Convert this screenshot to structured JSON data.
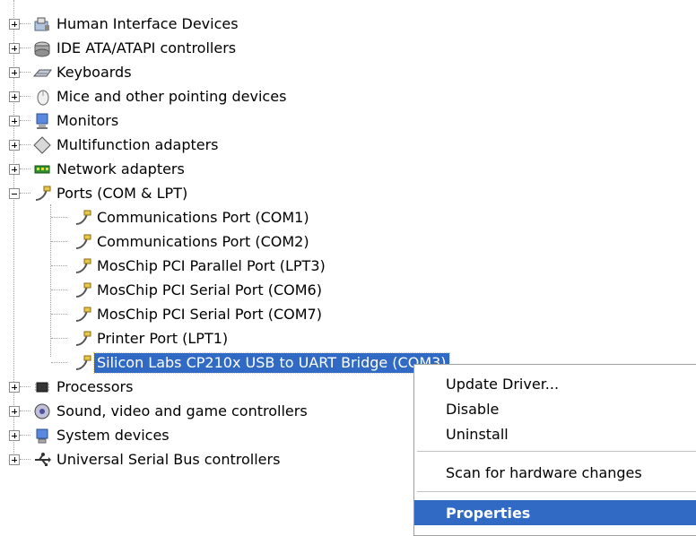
{
  "tree": {
    "categories": [
      {
        "label": "Human Interface Devices",
        "icon": "hid-icon"
      },
      {
        "label": "IDE ATA/ATAPI controllers",
        "icon": "ide-controller-icon"
      },
      {
        "label": "Keyboards",
        "icon": "keyboard-icon"
      },
      {
        "label": "Mice and other pointing devices",
        "icon": "mouse-icon"
      },
      {
        "label": "Monitors",
        "icon": "monitor-icon"
      },
      {
        "label": "Multifunction adapters",
        "icon": "multifunction-icon"
      },
      {
        "label": "Network adapters",
        "icon": "network-adapter-icon"
      },
      {
        "label": "Ports (COM & LPT)",
        "icon": "port-icon"
      },
      {
        "label": "Processors",
        "icon": "processor-icon"
      },
      {
        "label": "Sound, video and game controllers",
        "icon": "sound-icon"
      },
      {
        "label": "System devices",
        "icon": "system-devices-icon"
      },
      {
        "label": "Universal Serial Bus controllers",
        "icon": "usb-icon"
      }
    ],
    "ports": [
      {
        "label": "Communications Port (COM1)"
      },
      {
        "label": "Communications Port (COM2)"
      },
      {
        "label": "MosChip PCI Parallel Port (LPT3)"
      },
      {
        "label": "MosChip PCI Serial Port (COM6)"
      },
      {
        "label": "MosChip PCI Serial Port (COM7)"
      },
      {
        "label": "Printer Port (LPT1)"
      },
      {
        "label": "Silicon Labs CP210x USB to UART Bridge (COM3)",
        "selected": true
      }
    ]
  },
  "context_menu": {
    "items": [
      "Update Driver...",
      "Disable",
      "Uninstall"
    ],
    "scan": "Scan for hardware changes",
    "properties": "Properties"
  },
  "colors": {
    "selection": "#316ac5",
    "selection_text": "#ffffff"
  }
}
